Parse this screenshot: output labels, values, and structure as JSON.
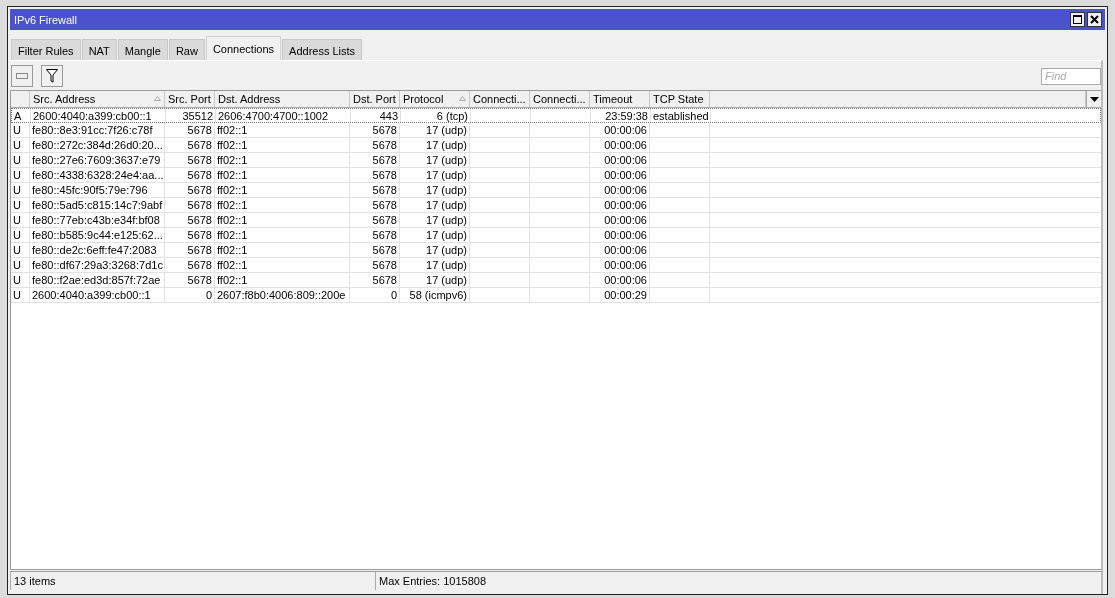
{
  "window": {
    "title": "IPv6 Firewall"
  },
  "tabs": [
    {
      "label": "Filter Rules",
      "selected": false
    },
    {
      "label": "NAT",
      "selected": false
    },
    {
      "label": "Mangle",
      "selected": false
    },
    {
      "label": "Raw",
      "selected": false
    },
    {
      "label": "Connections",
      "selected": true
    },
    {
      "label": "Address Lists",
      "selected": false
    }
  ],
  "search": {
    "placeholder": "Find"
  },
  "table": {
    "columns": [
      {
        "sorted": false
      },
      {
        "label": "Src. Address",
        "sorted": true
      },
      {
        "label": "Src. Port",
        "sorted": false
      },
      {
        "label": "Dst. Address",
        "sorted": false
      },
      {
        "label": "Dst. Port",
        "sorted": false
      },
      {
        "label": "Protocol",
        "sorted": true
      },
      {
        "label": "Connecti...",
        "sorted": false
      },
      {
        "label": "Connecti...",
        "sorted": false
      },
      {
        "label": "Timeout",
        "sorted": false
      },
      {
        "label": "TCP State",
        "sorted": false
      }
    ],
    "rows": [
      {
        "selected": true,
        "cells": [
          "A",
          "2600:4040:a399:cb00::1",
          "35512",
          "2606:4700:4700::1002",
          "443",
          "6 (tcp)",
          "",
          "",
          "23:59:38",
          "established"
        ]
      },
      {
        "selected": false,
        "cells": [
          "U",
          "fe80::8e3:91cc:7f26:c78f",
          "5678",
          "ff02::1",
          "5678",
          "17 (udp)",
          "",
          "",
          "00:00:06",
          ""
        ]
      },
      {
        "selected": false,
        "cells": [
          "U",
          "fe80::272c:384d:26d0:20...",
          "5678",
          "ff02::1",
          "5678",
          "17 (udp)",
          "",
          "",
          "00:00:06",
          ""
        ]
      },
      {
        "selected": false,
        "cells": [
          "U",
          "fe80::27e6:7609:3637:e79",
          "5678",
          "ff02::1",
          "5678",
          "17 (udp)",
          "",
          "",
          "00:00:06",
          ""
        ]
      },
      {
        "selected": false,
        "cells": [
          "U",
          "fe80::4338:6328:24e4:aa...",
          "5678",
          "ff02::1",
          "5678",
          "17 (udp)",
          "",
          "",
          "00:00:06",
          ""
        ]
      },
      {
        "selected": false,
        "cells": [
          "U",
          "fe80::45fc:90f5:79e:796",
          "5678",
          "ff02::1",
          "5678",
          "17 (udp)",
          "",
          "",
          "00:00:06",
          ""
        ]
      },
      {
        "selected": false,
        "cells": [
          "U",
          "fe80::5ad5:c815:14c7:9abf",
          "5678",
          "ff02::1",
          "5678",
          "17 (udp)",
          "",
          "",
          "00:00:06",
          ""
        ]
      },
      {
        "selected": false,
        "cells": [
          "U",
          "fe80::77eb:c43b:e34f:bf08",
          "5678",
          "ff02::1",
          "5678",
          "17 (udp)",
          "",
          "",
          "00:00:06",
          ""
        ]
      },
      {
        "selected": false,
        "cells": [
          "U",
          "fe80::b585:9c44:e125:62...",
          "5678",
          "ff02::1",
          "5678",
          "17 (udp)",
          "",
          "",
          "00:00:06",
          ""
        ]
      },
      {
        "selected": false,
        "cells": [
          "U",
          "fe80::de2c:6eff:fe47:2083",
          "5678",
          "ff02::1",
          "5678",
          "17 (udp)",
          "",
          "",
          "00:00:06",
          ""
        ]
      },
      {
        "selected": false,
        "cells": [
          "U",
          "fe80::df67:29a3:3268:7d1c",
          "5678",
          "ff02::1",
          "5678",
          "17 (udp)",
          "",
          "",
          "00:00:06",
          ""
        ]
      },
      {
        "selected": false,
        "cells": [
          "U",
          "fe80::f2ae:ed3d:857f:72ae",
          "5678",
          "ff02::1",
          "5678",
          "17 (udp)",
          "",
          "",
          "00:00:06",
          ""
        ]
      },
      {
        "selected": false,
        "cells": [
          "U",
          "2600:4040:a399:cb00::1",
          "0",
          "2607:f8b0:4006:809::200e",
          "0",
          "58 (icmpv6)",
          "",
          "",
          "00:00:29",
          ""
        ]
      }
    ]
  },
  "status_bar": {
    "items": "13 items",
    "max_entries": "Max Entries: 1015808"
  }
}
